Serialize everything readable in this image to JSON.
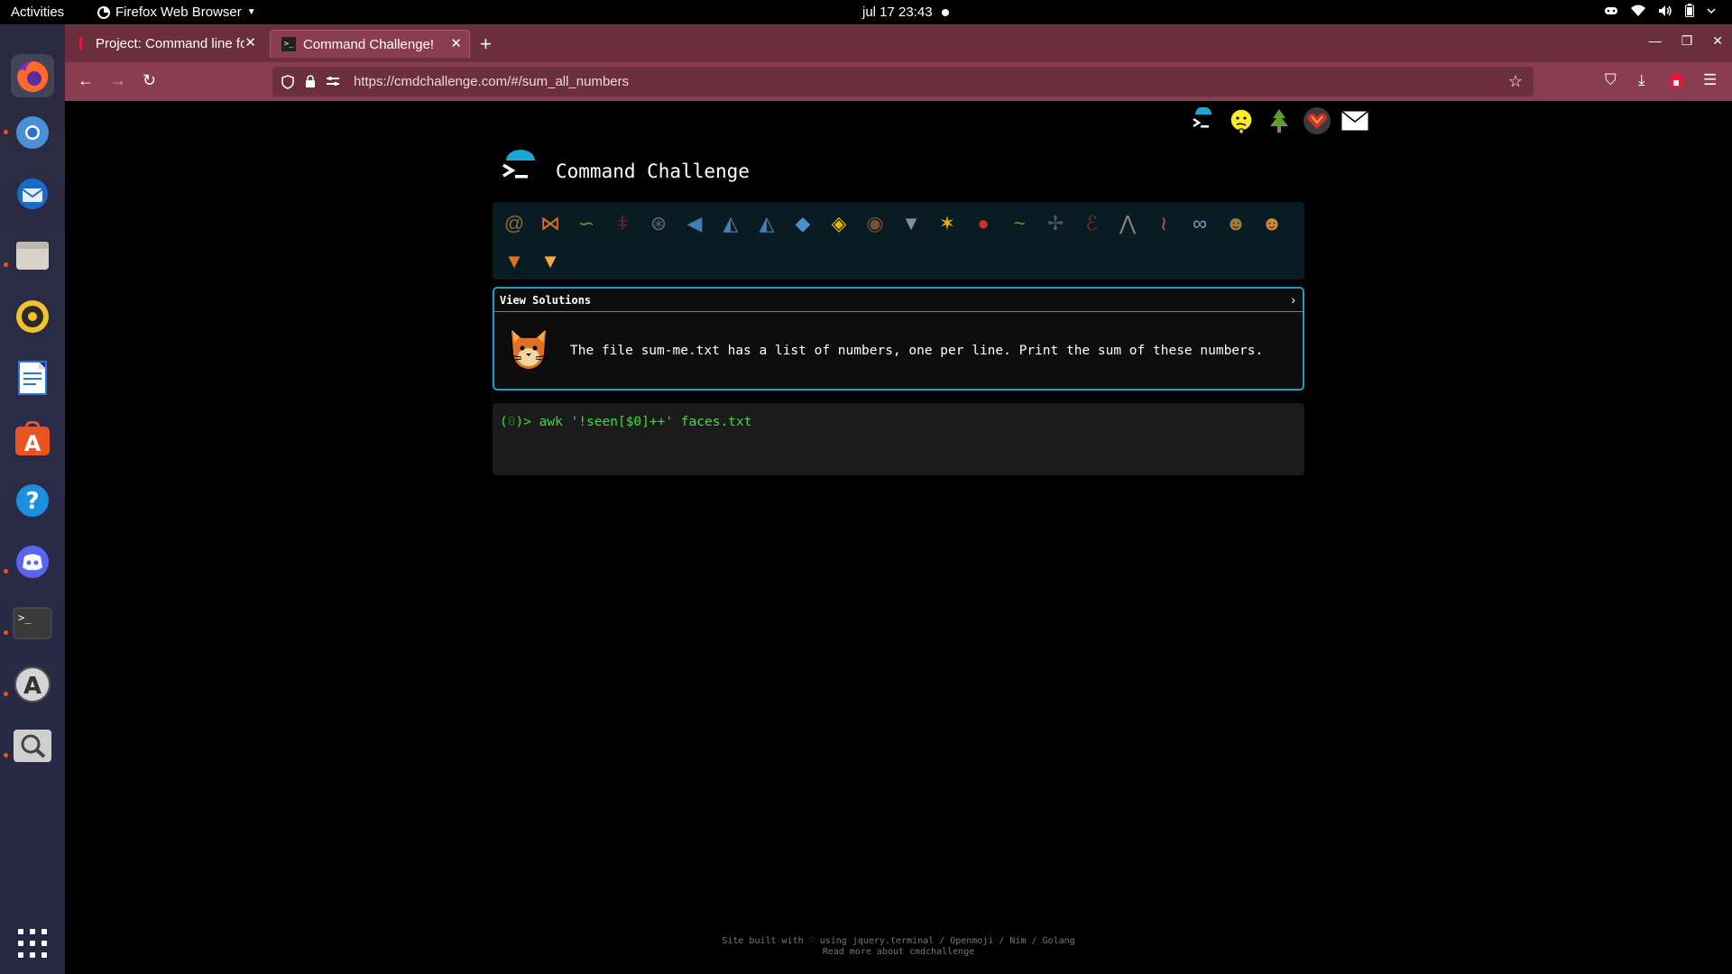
{
  "os": {
    "activities": "Activities",
    "app_name": "Firefox Web Browser",
    "clock": "jul 17  23:43"
  },
  "browser": {
    "tabs": [
      {
        "title": "Project: Command line fo"
      },
      {
        "title": "Command Challenge!"
      }
    ],
    "url": "https://cmdchallenge.com/#/sum_all_numbers"
  },
  "page": {
    "title": "Command Challenge",
    "view_solutions": "View Solutions",
    "challenge_text": "The file sum-me.txt has a list of numbers, one per line. Print the sum of these numbers.",
    "terminal": {
      "prompt_open": "(",
      "prompt_num": "0",
      "prompt_close": ")> ",
      "command": "awk '!seen[$0]++' faces.txt"
    },
    "footer_line1": "Site built with ♡ using jquery.terminal / Openmoji / Nim / Golang",
    "footer_line2": "Read more about cmdchallenge",
    "header_icons": [
      "terminal-icon",
      "idea-face-icon",
      "tree-icon",
      "heart-icon",
      "mail-icon"
    ],
    "challenge_icons_row1": [
      "snail-icon",
      "butterfly-icon",
      "caterpillar-icon",
      "ant-icon",
      "spider-web-icon",
      "whale-icon",
      "dolphin-icon",
      "dolphin-icon",
      "fish-icon",
      "tropical-fish-icon",
      "hedgehog-icon",
      "wolf-icon",
      "bee-icon",
      "ladybug-icon",
      "worm-icon",
      "mosquito-icon",
      "scorpion-icon",
      "fly-icon",
      "snake-icon",
      "chain-icon",
      "monkey-icon",
      "dog-icon"
    ],
    "challenge_icons_row2": [
      "fox-icon",
      "cat-icon"
    ]
  },
  "colors": {
    "tab_bar": "#6c2f3e",
    "nav_bar": "#8a3d50",
    "accent": "#1aa0c8",
    "prompt": "#3ddc3d"
  }
}
